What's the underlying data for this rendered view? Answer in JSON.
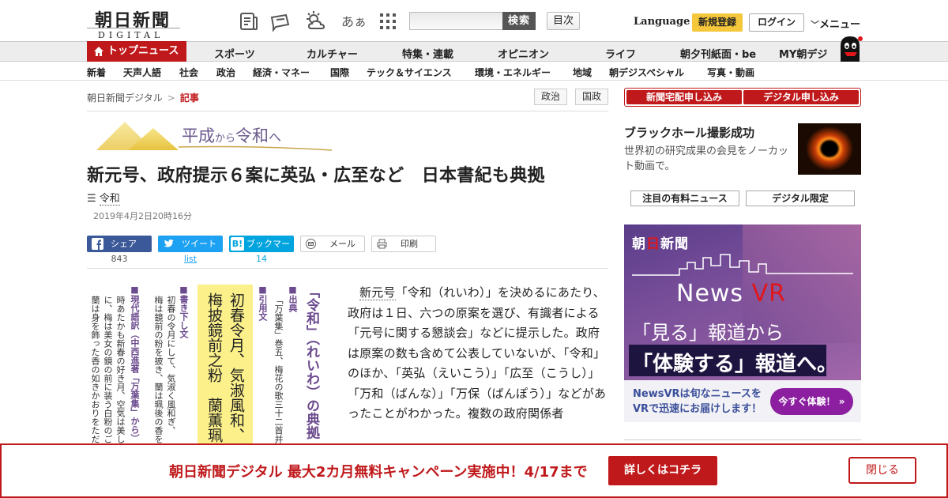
{
  "header": {
    "logo_main": "朝日新聞",
    "logo_sub": "DIGITAL",
    "icons": [
      "newspaper-icon",
      "message-icon",
      "weather-icon",
      "text-size-icon",
      "apps-grid-icon"
    ],
    "text_size_label": "あぁ",
    "search_placeholder": "",
    "search_button": "検索",
    "toc_button": "目次",
    "language": "Language",
    "register": "新規登録",
    "login": "ログイン",
    "menu": "メニュー"
  },
  "global_nav": {
    "top": "トップニュース",
    "items": [
      "スポーツ",
      "カルチャー",
      "特集・連載",
      "オピニオン",
      "ライフ",
      "朝夕刊紙面・be",
      "MY朝デジ"
    ]
  },
  "sub_nav": {
    "items": [
      "新着",
      "天声人語",
      "社会",
      "政治",
      "経済・マネー",
      "国際",
      "テック＆サイエンス",
      "環境・エネルギー",
      "地域",
      "朝デジスペシャル",
      "写真・動画"
    ]
  },
  "breadcrumb": {
    "home": "朝日新聞デジタル",
    "sep": ">",
    "current": "記事"
  },
  "tags": [
    "政治",
    "国政"
  ],
  "banner": {
    "a": "平成",
    "from": "から",
    "b": "令和",
    "to": "へ"
  },
  "article": {
    "headline": "新元号、政府提示６案に英弘・広至など　日本書紀も典拠",
    "topic_label": "令和",
    "date": "2019年4月2日20時16分",
    "body_link": "新元号",
    "body": "「令和（れいわ）」を決めるにあたり、政府は１日、六つの原案を選び、有識者による「元号に関する懇談会」などに提示した。政府は原案の数も含めて公表していないが、「令和」のほか、「英弘（えいこう）」「広至（こうし）」「万和（ばんな）」「万保（ばんぽう）」などがあったことがわかった。複数の政府関係者"
  },
  "share": {
    "facebook": "シェア",
    "twitter": "ツイート",
    "hatena": "ブックマーク",
    "mail": "メール",
    "print": "印刷",
    "facebook_count": "843",
    "twitter_count": "list",
    "hatena_count": "14"
  },
  "vertical": {
    "title": "「令和」（れいわ）の典拠",
    "source_label": "■出典",
    "source": "「万葉集」巻五、梅花の歌三十二首并せて",
    "quote_label": "■引用文",
    "quote1": "初春令月、気淑風和、",
    "quote2": "梅披鏡前之粉　蘭薫珮",
    "kaki_label": "■書き下し文",
    "kaki1": "初春の令月にして、気淑く風和ぎ、",
    "kaki2": "梅は鏡前の粉を披き、蘭は珮後の香を薫",
    "gendai_label": "■現代語訳（中西進著「万葉集」から）",
    "gendai1": "時あたかも新春の好き月、空気は美しく",
    "gendai2": "に、梅は美女の鏡の前に装う白粉のごとく",
    "gendai3": "蘭は身を飾った香の如きかおりをただよ"
  },
  "sidebar": {
    "delivery": "新聞宅配申し込み",
    "digital": "デジタル申し込み",
    "bh_title": "ブラックホール撮影成功",
    "bh_desc": "世界初の研究成果の会見をノーカット動画で。",
    "featured": "注目の有料ニュース",
    "digital_only": "デジタル限定"
  },
  "vr_ad": {
    "brand_a": "朝",
    "brand_b": "日",
    "brand_c": "新聞",
    "news": "News ",
    "vr": "VR",
    "line1": "「見る」報道から",
    "line2": "「体験する」報道へ。",
    "bottom": "NewsVRは旬なニュースをVRで迅速にお届けします！",
    "cta": "今すぐ体験！"
  },
  "campaign": {
    "message": "朝日新聞デジタル 最大2カ月無料キャンペーン実施中！4/17まで",
    "more": "詳しくはコチラ",
    "close": "閉じる"
  },
  "colors": {
    "brand_red": "#c0191b",
    "yellow": "#f5c73a",
    "purple": "#8c5aa0",
    "facebook": "#3b5998",
    "twitter": "#1da1f2",
    "hatena": "#00a4de"
  }
}
